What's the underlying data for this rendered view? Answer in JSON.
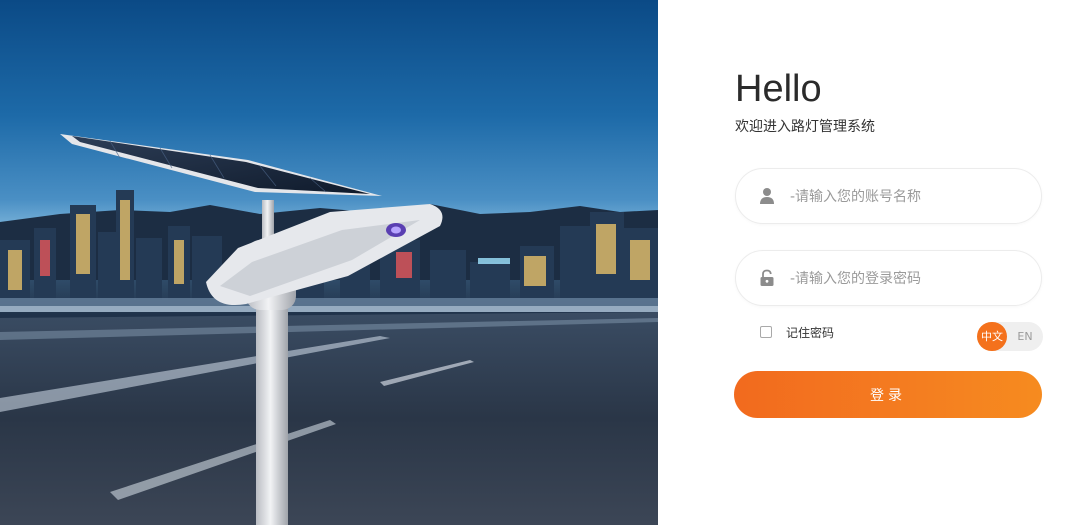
{
  "hero": {
    "image_alt": "solar street light over city skyline at dusk"
  },
  "login": {
    "greeting": "Hello",
    "subtitle": "欢迎进入路灯管理系统",
    "username": {
      "placeholder": "-请输入您的账号名称",
      "value": "",
      "icon": "user-icon"
    },
    "password": {
      "placeholder": "-请输入您的登录密码",
      "value": "",
      "icon": "lock-icon"
    },
    "remember_label": "记住密码",
    "remember_checked": false,
    "language": {
      "options": [
        "中文",
        "EN"
      ],
      "selected": "中文"
    },
    "submit_label": "登录"
  },
  "colors": {
    "accent": "#f4711c",
    "button_start": "#f26a1e",
    "button_end": "#f68b1f",
    "field_border": "#ececec",
    "placeholder": "#9a9a9a"
  }
}
